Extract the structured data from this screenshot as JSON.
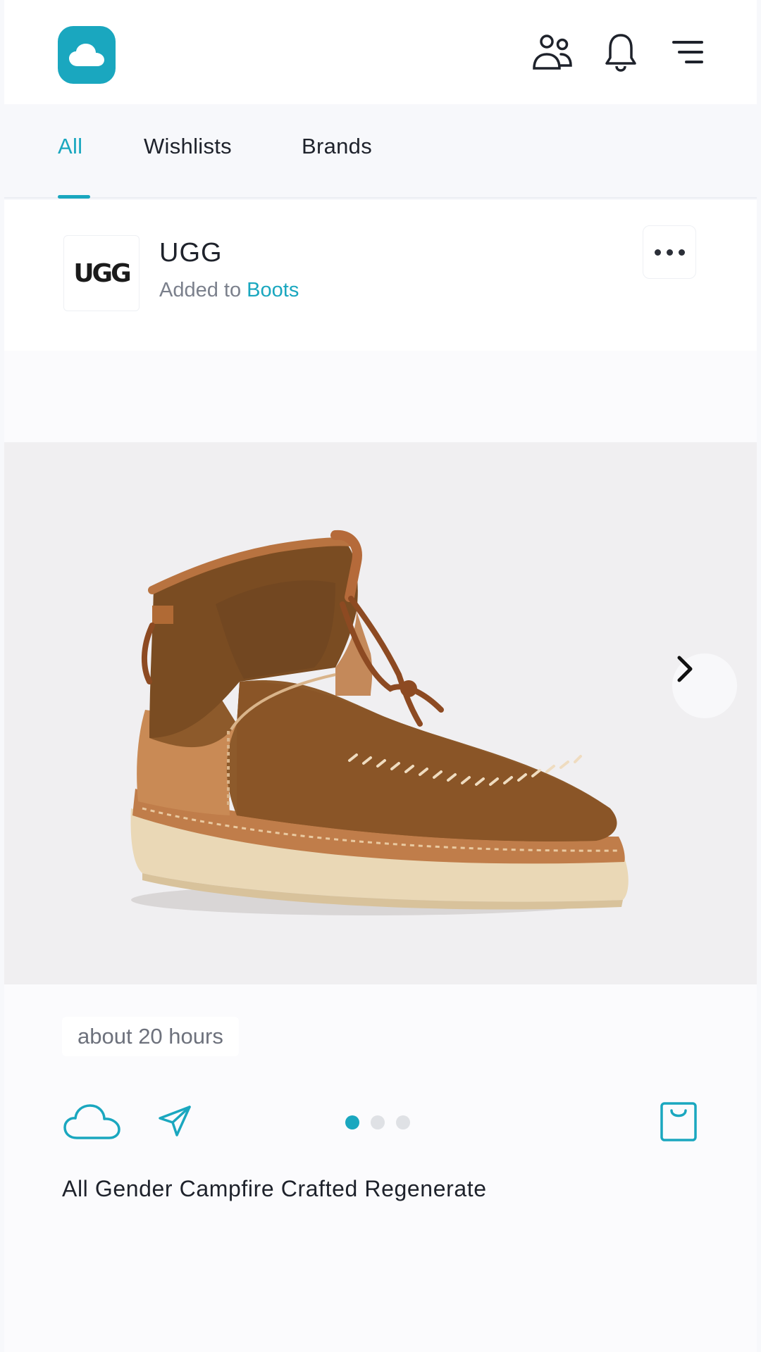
{
  "header": {
    "logo_icon": "cloud-icon",
    "icons": [
      "people-icon",
      "bell-icon",
      "filter-icon"
    ],
    "accent_color": "#1aa7bf"
  },
  "tabs": {
    "items": [
      {
        "label": "All",
        "active": true
      },
      {
        "label": "Wishlists",
        "active": false
      },
      {
        "label": "Brands",
        "active": false
      }
    ]
  },
  "post": {
    "brand_logo_text": "UGG",
    "brand_name": "UGG",
    "added_prefix": "Added to",
    "added_target": "Boots",
    "more_icon": "ellipsis-icon",
    "image_alt": "boot-image",
    "next_icon": "chevron-right-icon",
    "timestamp": "about 20 hours",
    "carousel": {
      "count": 3,
      "active_index": 0
    },
    "product_title": "All Gender Campfire Crafted Regenerate",
    "action_icons": [
      "cloud-outline-icon",
      "send-icon",
      "shopping-bag-icon"
    ]
  }
}
